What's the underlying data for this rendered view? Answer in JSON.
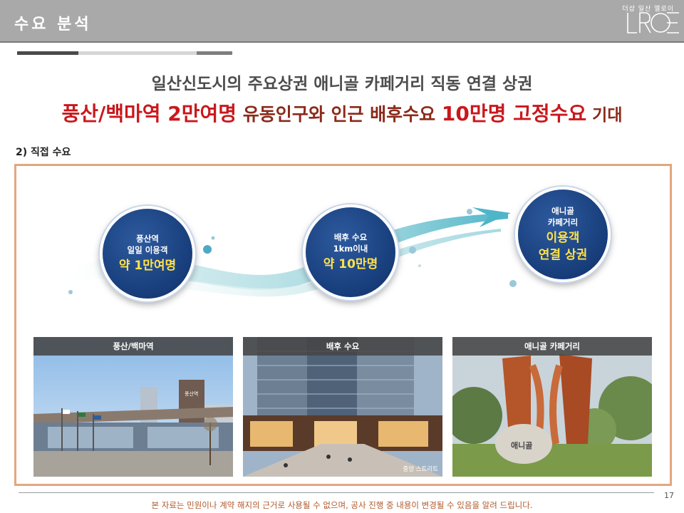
{
  "header": {
    "title": "수요 분석",
    "brand_sub": "더샵 일산 엘로이",
    "brand_logo": "LROE"
  },
  "headline": {
    "line1": "일산신도시의 주요상권 애니골 카페거리 직동 연결 상권",
    "line2_part1": "풍산/백마역 2만여명",
    "line2_part2": " 유동인구와 인근 배후수요 ",
    "line2_part3": "10만명 고정수요",
    "line2_part4": " 기대"
  },
  "section_label": "2) 직접 수요",
  "circles": [
    {
      "line1": "풍산역",
      "line2": "일일 이용객",
      "big": "약 1만여명"
    },
    {
      "line1": "배후 수요",
      "line2": "1km이내",
      "big": "약 10만명"
    },
    {
      "line1": "애니골",
      "line2": "카페거리",
      "big1": "이용객",
      "big2": "연결 상권"
    }
  ],
  "photos": [
    {
      "title": "풍산/백마역",
      "caption": ""
    },
    {
      "title": "배후 수요",
      "caption": "중앙 스트리트"
    },
    {
      "title": "애니골 카페거리",
      "caption": ""
    }
  ],
  "photo_texts": {
    "station_sign": "풍산역",
    "rock_text": "애니골"
  },
  "footer": {
    "disclaimer": "본 자료는 민원이나 계약 해지의 근거로 사용될 수 없으며, 공사 진행 중 내용이 변경될 수 있음을 알려 드립니다.",
    "page": "17"
  },
  "colors": {
    "accent_red": "#c9181c",
    "circle_blue": "#173d7a",
    "highlight_yellow": "#ffe14a",
    "frame_orange": "#e2a77d",
    "header_gray": "#a9a9a9"
  }
}
